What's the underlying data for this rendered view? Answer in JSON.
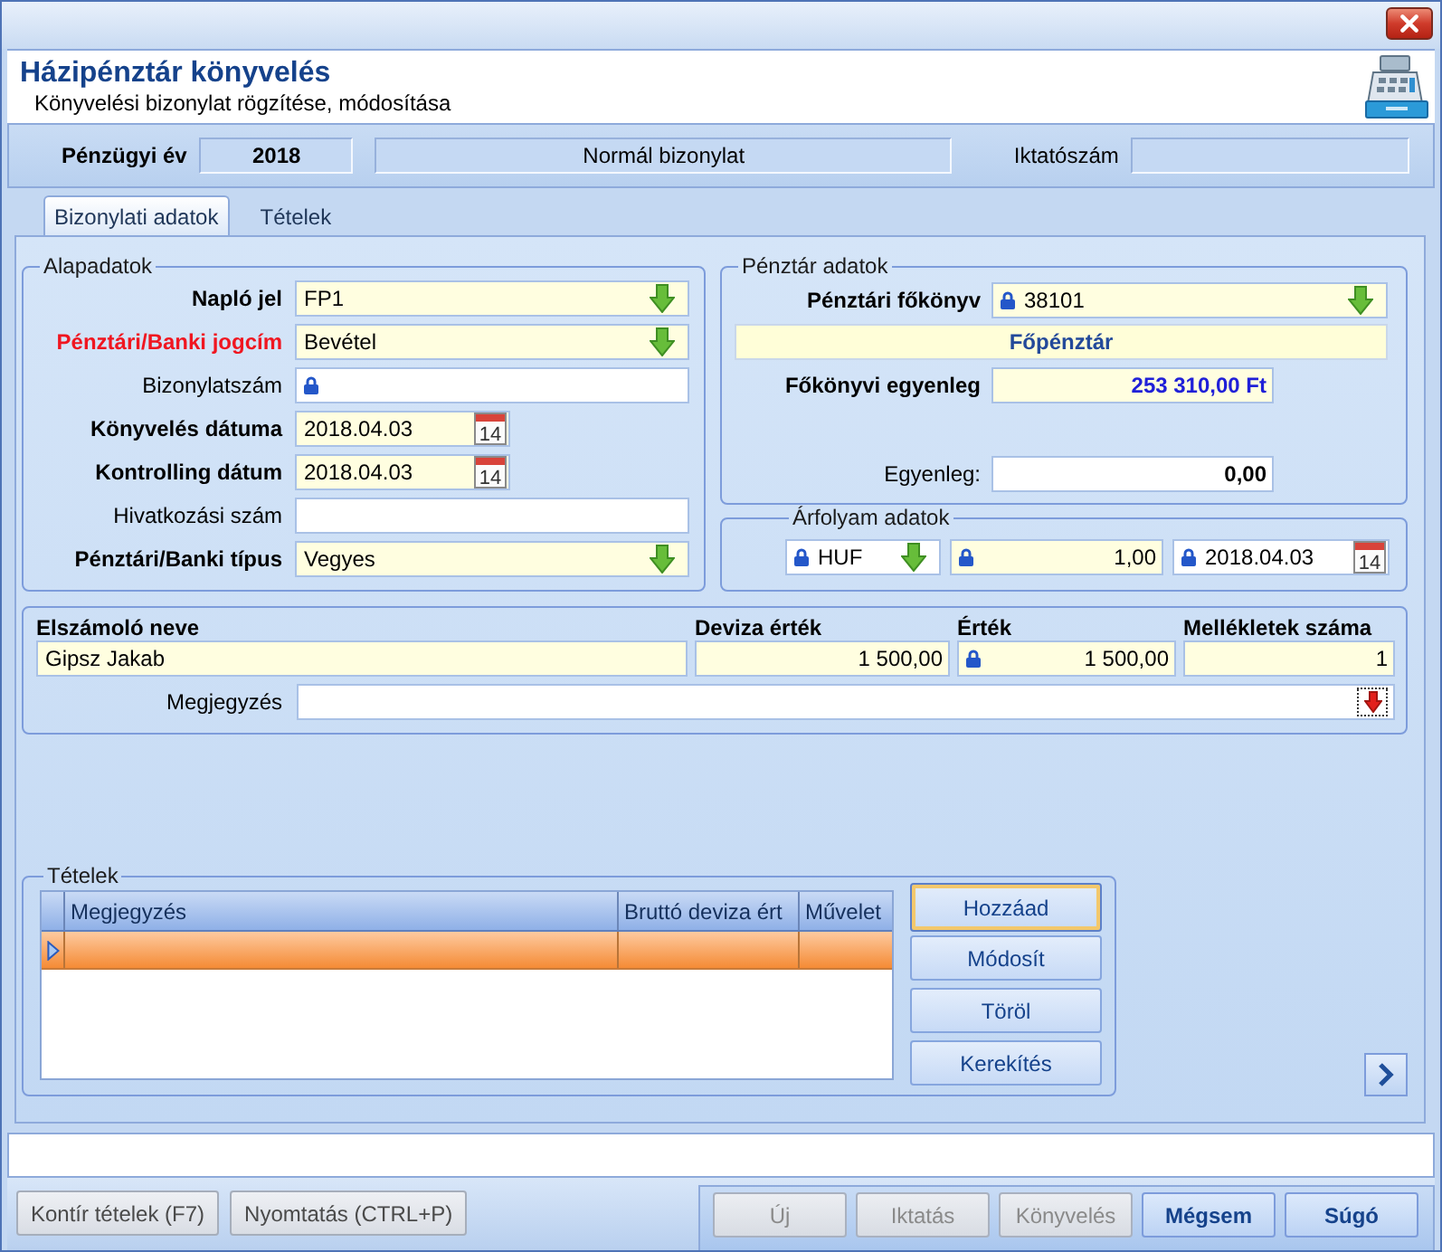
{
  "header": {
    "title": "Házipénztár könyvelés",
    "subtitle": "Könyvelési bizonylat rögzítése, módosítása"
  },
  "info_bar": {
    "fiscal_year_label": "Pénzügyi év",
    "fiscal_year": "2018",
    "document_type": "Normál bizonylat",
    "filing_number_label": "Iktatószám"
  },
  "tabs": [
    {
      "label": "Bizonylati adatok",
      "selected": true
    },
    {
      "label": "Tételek",
      "selected": false
    }
  ],
  "basic_data": {
    "title": "Alapadatok",
    "fields": [
      {
        "label": "Napló jel",
        "value": "FP1",
        "kind": "dropdown",
        "required": true,
        "invalid": false,
        "locked": false
      },
      {
        "label": "Pénztári/Banki jogcím",
        "value": "Bevétel",
        "kind": "dropdown",
        "required": true,
        "invalid": true,
        "locked": false
      },
      {
        "label": "Bizonylatszám",
        "kind": "text",
        "required": false,
        "invalid": false,
        "locked": true
      },
      {
        "label": "Könyvelés dátuma",
        "value": "2018.04.03",
        "kind": "date",
        "calendar_day": "14",
        "required": true,
        "invalid": false,
        "locked": false
      },
      {
        "label": "Kontrolling dátum",
        "value": "2018.04.03",
        "kind": "date",
        "calendar_day": "14",
        "required": true,
        "invalid": false,
        "locked": false
      },
      {
        "label": "Hivatkozási szám",
        "kind": "text",
        "required": false,
        "invalid": false,
        "locked": false
      },
      {
        "label": "Pénztári/Banki típus",
        "value": "Vegyes",
        "kind": "dropdown",
        "required": true,
        "invalid": false,
        "locked": false
      }
    ]
  },
  "cash_data": {
    "title": "Pénztár adatok",
    "ledger": {
      "label": "Pénztári főkönyv",
      "value": "38101",
      "required": true,
      "locked": true
    },
    "cash_desk": "Főpénztár",
    "ledger_balance": {
      "label": "Főkönyvi egyenleg",
      "value": "253 310,00 Ft",
      "required": true
    },
    "balance": {
      "label": "Egyenleg:",
      "value": "0,00",
      "required": false
    }
  },
  "exchange_rate": {
    "title": "Árfolyam adatok",
    "fields": [
      {
        "value": "HUF",
        "kind": "dropdown",
        "required": false,
        "locked": true
      },
      {
        "value": "1,00",
        "kind": "number",
        "required": true,
        "locked": true
      },
      {
        "value": "2018.04.03",
        "kind": "date",
        "calendar_day": "14",
        "required": false,
        "locked": true
      }
    ]
  },
  "settlement": {
    "columns": [
      "Elszámoló neve",
      "Deviza érték",
      "Érték",
      "Mellékletek száma"
    ],
    "fields": [
      {
        "value": "Gipsz Jakab",
        "kind": "text",
        "required": true,
        "locked": false
      },
      {
        "value": "1 500,00",
        "kind": "number",
        "required": true,
        "locked": false
      },
      {
        "value": "1 500,00",
        "kind": "number",
        "required": true,
        "locked": true
      },
      {
        "value": "1",
        "kind": "number",
        "required": true,
        "locked": false
      }
    ],
    "note": {
      "label": "Megjegyzés",
      "required": false
    }
  },
  "items": {
    "title": "Tételek",
    "table": {
      "columns": [
        "Megjegyzés",
        "Bruttó deviza ért",
        "Művelet"
      ],
      "rows": [
        {
          "selected": true
        }
      ]
    },
    "buttons": [
      {
        "label": "Hozzáad",
        "focused": true
      },
      {
        "label": "Módosít",
        "focused": false
      },
      {
        "label": "Töröl",
        "focused": false
      },
      {
        "label": "Kerekítés",
        "focused": false
      }
    ]
  },
  "footer": {
    "left_buttons": [
      {
        "label": "Kontír tételek (F7)",
        "disabled": false
      },
      {
        "label": "Nyomtatás (CTRL+P)",
        "disabled": false
      }
    ],
    "right_buttons": [
      {
        "label": "Új",
        "disabled": true
      },
      {
        "label": "Iktatás",
        "disabled": true
      },
      {
        "label": "Könyvelés",
        "disabled": true
      },
      {
        "label": "Mégsem",
        "disabled": false
      },
      {
        "label": "Súgó",
        "disabled": false
      }
    ]
  }
}
